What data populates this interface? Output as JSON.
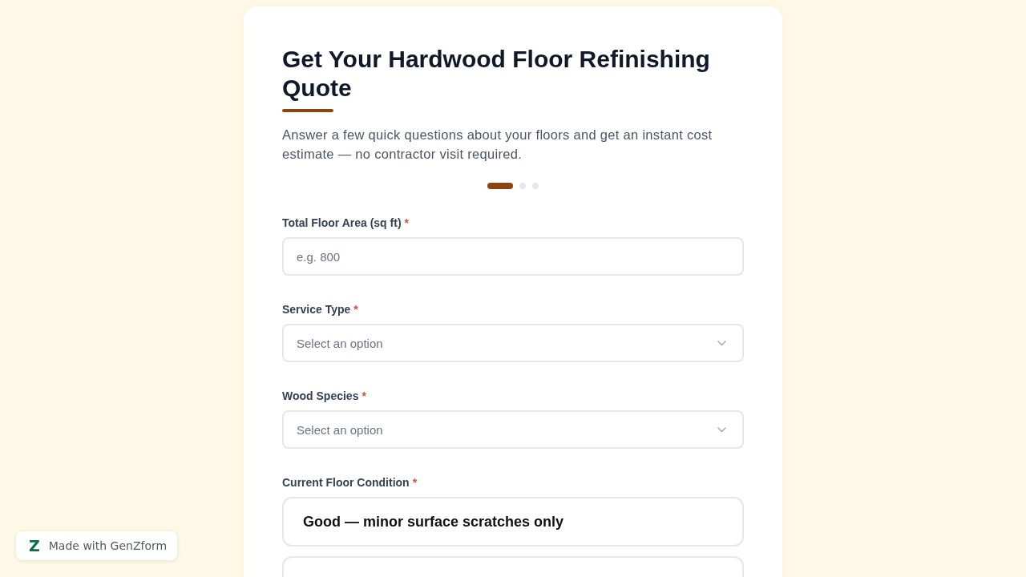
{
  "form": {
    "title": "Get Your Hardwood Floor Refinishing Quote",
    "description": "Answer a few quick questions about your floors and get an instant cost estimate — no contractor visit required.",
    "steps": [
      {
        "selected": true
      },
      {
        "selected": false
      },
      {
        "selected": false
      }
    ],
    "fields": [
      {
        "kind": "text",
        "label": "Total Floor Area (sq ft)",
        "required_mark": "*",
        "placeholder": "e.g. 800"
      },
      {
        "kind": "select",
        "label": "Service Type",
        "required_mark": "*",
        "placeholder": "Select an option"
      },
      {
        "kind": "select",
        "label": "Wood Species",
        "required_mark": "*",
        "placeholder": "Select an option"
      },
      {
        "kind": "choice",
        "label": "Current Floor Condition",
        "required_mark": "*",
        "options": [
          {
            "label": "Good — minor surface scratches only",
            "selected": false
          },
          {
            "selected": false
          }
        ]
      }
    ]
  },
  "badge": {
    "logo": "Z",
    "text": "Made with GenZform"
  }
}
